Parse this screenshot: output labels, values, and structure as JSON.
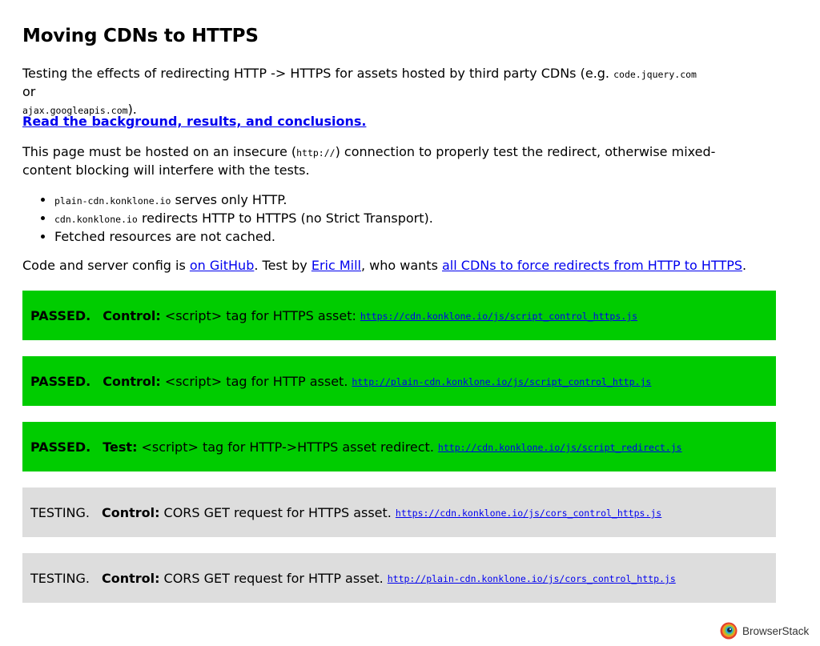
{
  "page": {
    "title": "Moving CDNs to HTTPS"
  },
  "intro": {
    "text_before": "Testing the effects of redirecting HTTP -> HTTPS for assets hosted by third party CDNs (e.g. ",
    "code1": "code.jquery.com",
    "or_text": " or ",
    "code2": "ajax.googleapis.com",
    "text_after": ")."
  },
  "background_link": "Read the background, results, and conclusions.",
  "insecure_note": {
    "before": "This page must be hosted on an insecure (",
    "code": "http://",
    "after": ") connection to properly test the redirect, otherwise mixed-content blocking will interfere with the tests."
  },
  "bullets": [
    {
      "code": "plain-cdn.konklone.io",
      "text": " serves only HTTP."
    },
    {
      "code": "cdn.konklone.io",
      "text": " redirects HTTP to HTTPS (no Strict Transport)."
    },
    {
      "code": "",
      "text": "Fetched resources are not cached."
    }
  ],
  "credits": {
    "t1": "Code and server config is ",
    "github_link": "on GitHub",
    "t2": ". Test by ",
    "author_link": "Eric Mill",
    "t3": ", who wants ",
    "cdn_link": "all CDNs to force redirects from HTTP to HTTPS",
    "t4": "."
  },
  "results": [
    {
      "status": "PASSED.",
      "kind": "Control:",
      "desc": "<script> tag for HTTPS asset:",
      "url": "https://cdn.konklone.io/js/script_control_https.js",
      "state": "passed"
    },
    {
      "status": "PASSED.",
      "kind": "Control:",
      "desc": "<script> tag for HTTP asset.",
      "url": "http://plain-cdn.konklone.io/js/script_control_http.js",
      "state": "passed"
    },
    {
      "status": "PASSED.",
      "kind": "Test:",
      "desc": "<script> tag for HTTP->HTTPS asset redirect.",
      "url": "http://cdn.konklone.io/js/script_redirect.js",
      "state": "passed"
    },
    {
      "status": "TESTING.",
      "kind": "Control:",
      "desc": "CORS GET request for HTTPS asset.",
      "url": "https://cdn.konklone.io/js/cors_control_https.js",
      "state": "testing"
    },
    {
      "status": "TESTING.",
      "kind": "Control:",
      "desc": "CORS GET request for HTTP asset.",
      "url": "http://plain-cdn.konklone.io/js/cors_control_http.js",
      "state": "testing"
    }
  ],
  "colors": {
    "passed_bg": "#00cc00",
    "testing_bg": "#dddddd",
    "link": "#0000ee"
  },
  "branding": {
    "name": "BrowserStack",
    "icon": "browserstack-logo-icon"
  }
}
